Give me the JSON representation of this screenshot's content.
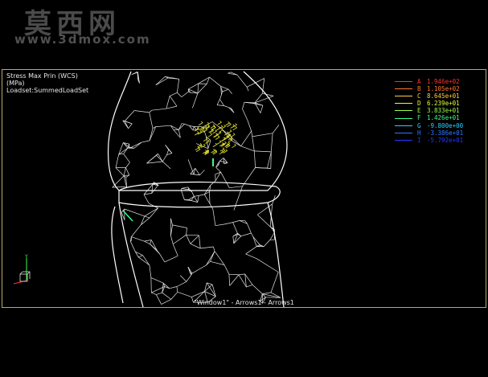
{
  "watermark": {
    "title": "莫西网",
    "url": "www.3dmox.com"
  },
  "info": {
    "line1": "Stress Max Prin (WCS)",
    "line2": "(MPa)",
    "line3": "Loadset:SummedLoadSet"
  },
  "legend": [
    {
      "letter": "A",
      "value": "1.946e+02",
      "color": "#ff3030"
    },
    {
      "letter": "B",
      "value": "1.105e+02",
      "color": "#ff7a2a"
    },
    {
      "letter": "C",
      "value": "8.645e+01",
      "color": "#ffd040"
    },
    {
      "letter": "D",
      "value": "6.239e+01",
      "color": "#e4ff3a"
    },
    {
      "letter": "E",
      "value": "3.833e+01",
      "color": "#9aff4a"
    },
    {
      "letter": "F",
      "value": "1.426e+01",
      "color": "#3aff8a"
    },
    {
      "letter": "G",
      "value": "-9.800e+00",
      "color": "#2ad2ff"
    },
    {
      "letter": "H",
      "value": "-3.386e+01",
      "color": "#2a7aff"
    },
    {
      "letter": "I",
      "value": "-5.792e+01",
      "color": "#2a34ff"
    }
  ],
  "status": "\"Window1\" - Arrows1 - Arrows1",
  "colors": {
    "frame": "#b8aa6e",
    "mesh": "#ffffff",
    "load_arrows": "#e6e62a",
    "background": "#000000"
  }
}
